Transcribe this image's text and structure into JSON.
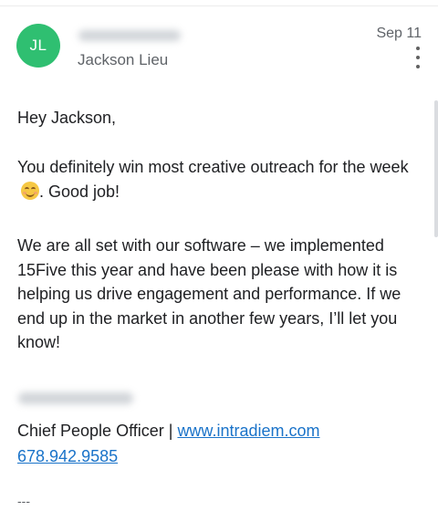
{
  "message": {
    "avatar_initials": "JL",
    "sender_name": "Jackson Lieu",
    "date": "Sep 11",
    "greeting": "Hey Jackson,",
    "paragraph1_part1": "You definitely win most creative outreach for the week",
    "paragraph1_part2": ". Good job!",
    "paragraph2": "We are all set with our software – we implemented 15Five this year and have been please with how it is helping us drive engagement and performance. If we end up in the market in another few years, I’ll let you know!",
    "signature_title": "Chief People Officer | ",
    "website": "www.intradiem.com",
    "phone": "678.942.9585",
    "footer_dashes": "---"
  },
  "colors": {
    "avatar_background": "#2fbf71",
    "link": "#1a73c9",
    "secondary_text": "#5f6368"
  },
  "icons": {
    "more_options": "more-vertical-icon",
    "emoji": "smiling-face-emoji"
  }
}
